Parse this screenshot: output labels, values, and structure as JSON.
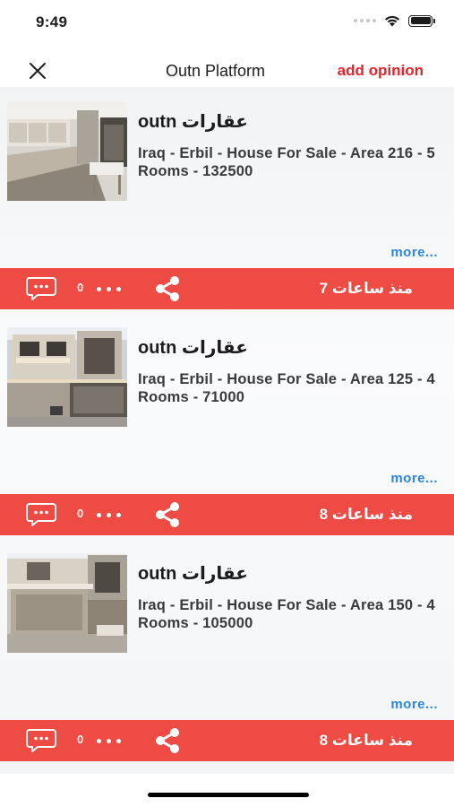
{
  "status_bar": {
    "time": "9:49",
    "icons": [
      "signal-icon",
      "wifi-icon",
      "battery-icon"
    ]
  },
  "nav": {
    "close_icon": "close-icon",
    "title": "Outn Platform",
    "add_opinion": "add opinion"
  },
  "colors": {
    "accent_red": "#e8232b",
    "action_bar": "#ef4b45",
    "link_blue": "#2f86d8"
  },
  "posts": [
    {
      "title": "outn عقارات",
      "description": "Iraq - Erbil - House For Sale - Area 216 - 5 Rooms - 132500",
      "more": "more...",
      "comment_count": "0",
      "time_ago": "منذ ساعات 7"
    },
    {
      "title": "outn عقارات",
      "description": "Iraq - Erbil - House For Sale - Area 125 - 4 Rooms - 71000",
      "more": "more...",
      "comment_count": "0",
      "time_ago": "منذ ساعات 8"
    },
    {
      "title": "outn عقارات",
      "description": "Iraq - Erbil - House For Sale - Area 150 - 4 Rooms - 105000",
      "more": "more...",
      "comment_count": "0",
      "time_ago": "منذ ساعات 8"
    }
  ]
}
